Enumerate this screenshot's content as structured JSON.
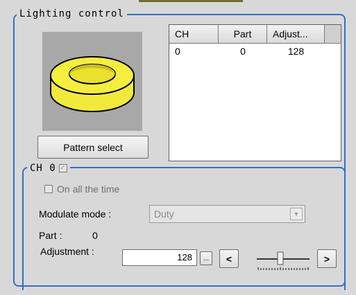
{
  "group": {
    "title": "Lighting control"
  },
  "pattern_button": "Pattern select",
  "table": {
    "headers": [
      "CH",
      "Part",
      "Adjust..."
    ],
    "rows": [
      [
        "0",
        "0",
        "128"
      ]
    ]
  },
  "channel": {
    "title": "CH 0",
    "enabled_checked": true,
    "on_all_time_label": "On all the time",
    "modulate_label": "Modulate mode :",
    "modulate_value": "Duty",
    "part_label": "Part :",
    "part_value": "0",
    "adjustment_label": "Adjustment :",
    "adjustment_value": "128",
    "ellipsis_label": "...",
    "prev_label": "<",
    "next_label": ">"
  },
  "colors": {
    "group_border": "#2f6fcf",
    "ring": "#f2ea3b"
  }
}
